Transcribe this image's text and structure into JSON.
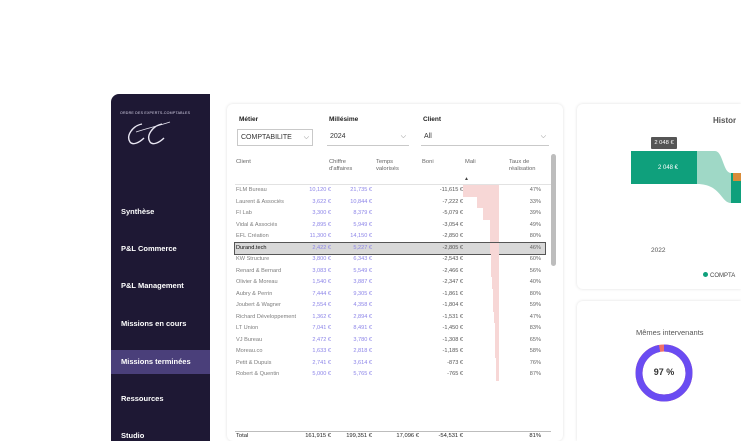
{
  "sidebar": {
    "org_name": "ORDRE DES EXPERTS-COMPTABLES",
    "items": [
      {
        "label": "Synthèse",
        "active": false
      },
      {
        "label": "P&L Commerce",
        "active": false
      },
      {
        "label": "P&L Management",
        "active": false
      },
      {
        "label": "Missions en cours",
        "active": false
      },
      {
        "label": "Missions terminées",
        "active": true
      },
      {
        "label": "Ressources",
        "active": false
      },
      {
        "label": "Studio",
        "active": false
      }
    ]
  },
  "filters": {
    "metier": {
      "label": "Métier",
      "value": "COMPTABILITE"
    },
    "millesime": {
      "label": "Millésime",
      "value": "2024"
    },
    "client": {
      "label": "Client",
      "value": "All"
    }
  },
  "table": {
    "headers": {
      "client": "Client",
      "ca": "Chiffre d'affaires",
      "temps": "Temps valorisés",
      "boni": "Boni",
      "mali": "Mali",
      "taux": "Taux de réalisation"
    },
    "sort_indicator": "▲",
    "rows": [
      {
        "client": "FLM Bureau",
        "ca": "10,120 €",
        "temps": "21,735 €",
        "mali": "-11,615 €",
        "taux": "47%",
        "mali_ratio": 1.0
      },
      {
        "client": "Laurent & Associés",
        "ca": "3,622 €",
        "temps": "10,844 €",
        "mali": "-7,222 €",
        "taux": "33%",
        "mali_ratio": 0.62
      },
      {
        "client": "FI Lab",
        "ca": "3,300 €",
        "temps": "8,379 €",
        "mali": "-5,079 €",
        "taux": "39%",
        "mali_ratio": 0.44
      },
      {
        "client": "Vidal & Associés",
        "ca": "2,895 €",
        "temps": "5,949 €",
        "mali": "-3,054 €",
        "taux": "49%",
        "mali_ratio": 0.26
      },
      {
        "client": "EFL Création",
        "ca": "11,300 €",
        "temps": "14,150 €",
        "mali": "-2,850 €",
        "taux": "80%",
        "mali_ratio": 0.25
      },
      {
        "client": "Durand.tech",
        "ca": "2,422 €",
        "temps": "5,227 €",
        "mali": "-2,805 €",
        "taux": "46%",
        "mali_ratio": 0.24,
        "highlight": true
      },
      {
        "client": "KW Structure",
        "ca": "3,800 €",
        "temps": "6,343 €",
        "mali": "-2,543 €",
        "taux": "60%",
        "mali_ratio": 0.22
      },
      {
        "client": "Renard & Bernard",
        "ca": "3,083 €",
        "temps": "5,549 €",
        "mali": "-2,466 €",
        "taux": "56%",
        "mali_ratio": 0.21
      },
      {
        "client": "Olivier & Moreau",
        "ca": "1,540 €",
        "temps": "3,887 €",
        "mali": "-2,347 €",
        "taux": "40%",
        "mali_ratio": 0.2
      },
      {
        "client": "Aubry & Perrin",
        "ca": "7,444 €",
        "temps": "9,305 €",
        "mali": "-1,861 €",
        "taux": "80%",
        "mali_ratio": 0.16
      },
      {
        "client": "Joubert & Wagner",
        "ca": "2,554 €",
        "temps": "4,358 €",
        "mali": "-1,804 €",
        "taux": "59%",
        "mali_ratio": 0.16
      },
      {
        "client": "Richard Développement",
        "ca": "1,362 €",
        "temps": "2,894 €",
        "mali": "-1,531 €",
        "taux": "47%",
        "mali_ratio": 0.13
      },
      {
        "client": "LT Union",
        "ca": "7,041 €",
        "temps": "8,491 €",
        "mali": "-1,450 €",
        "taux": "83%",
        "mali_ratio": 0.12
      },
      {
        "client": "VJ Bureau",
        "ca": "2,472 €",
        "temps": "3,780 €",
        "mali": "-1,308 €",
        "taux": "65%",
        "mali_ratio": 0.11
      },
      {
        "client": "Moreau.co",
        "ca": "1,633 €",
        "temps": "2,818 €",
        "mali": "-1,185 €",
        "taux": "58%",
        "mali_ratio": 0.1
      },
      {
        "client": "Petit & Dupuis",
        "ca": "2,741 €",
        "temps": "3,614 €",
        "mali": "-873 €",
        "taux": "76%",
        "mali_ratio": 0.08
      },
      {
        "client": "Robert & Quentin",
        "ca": "5,000 €",
        "temps": "5,765 €",
        "mali": "-765 €",
        "taux": "87%",
        "mali_ratio": 0.07
      }
    ],
    "total": {
      "label": "Total",
      "ca": "161,915 €",
      "temps": "199,351 €",
      "boni": "17,096 €",
      "mali": "-54,531 €",
      "taux": "81%"
    }
  },
  "historique": {
    "title": "Histor",
    "tag": "2 048 €",
    "bar_label": "2 048 €",
    "year": "2022",
    "legend": "COMPTA",
    "colors": {
      "bar": "#0fa07c",
      "flow": "#9fd8c6",
      "accent": "#d98c3a"
    }
  },
  "memes_intervenants": {
    "title": "Mêmes intervenants",
    "value": "97 %",
    "percent": 97,
    "colors": {
      "main": "#6a4cf2",
      "rest": "#f07068"
    }
  }
}
